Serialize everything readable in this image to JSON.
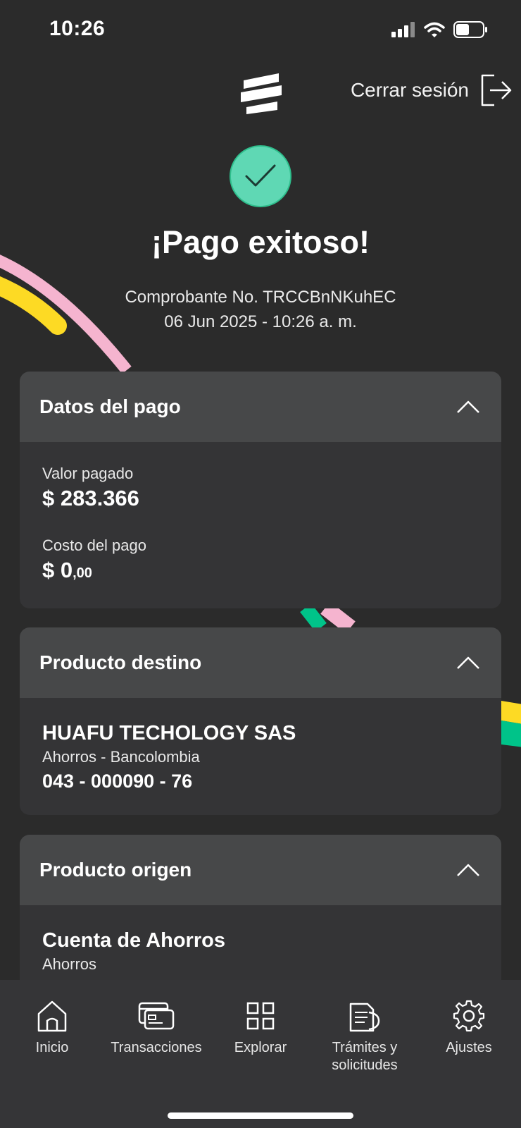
{
  "status_bar": {
    "time": "10:26"
  },
  "header": {
    "logout_label": "Cerrar sesión"
  },
  "success": {
    "title": "¡Pago exitoso!",
    "receipt_line": "Comprobante No. TRCCBnNKuhEC",
    "date_line": "06 Jun 2025 - 10:26 a. m."
  },
  "payment_card": {
    "title": "Datos del pago",
    "value_label": "Valor pagado",
    "value_amount": "$ 283.366",
    "cost_label": "Costo del pago",
    "cost_amount": "$ 0",
    "cost_cents": ",00"
  },
  "destination_card": {
    "title": "Producto destino",
    "name": "HUAFU TECHOLOGY SAS",
    "type": "Ahorros - Bancolombia",
    "number": "043 - 000090 - 76"
  },
  "origin_card": {
    "title": "Producto origen",
    "name": "Cuenta de Ahorros",
    "type": "Ahorros"
  },
  "bottom_nav": {
    "items": [
      {
        "label": "Inicio",
        "icon": "home-icon"
      },
      {
        "label": "Transacciones",
        "icon": "transactions-card-icon"
      },
      {
        "label": "Explorar",
        "icon": "grid-icon"
      },
      {
        "label": "Trámites y solicitudes",
        "icon": "document-icon"
      },
      {
        "label": "Ajustes",
        "icon": "gear-icon"
      }
    ]
  },
  "colors": {
    "background": "#2b2b2b",
    "card": "#343436",
    "card_header": "#474849",
    "success_green": "#5fd8b4",
    "accent_yellow": "#fdda24",
    "accent_pink": "#f5b4cf",
    "accent_green": "#00c389"
  }
}
